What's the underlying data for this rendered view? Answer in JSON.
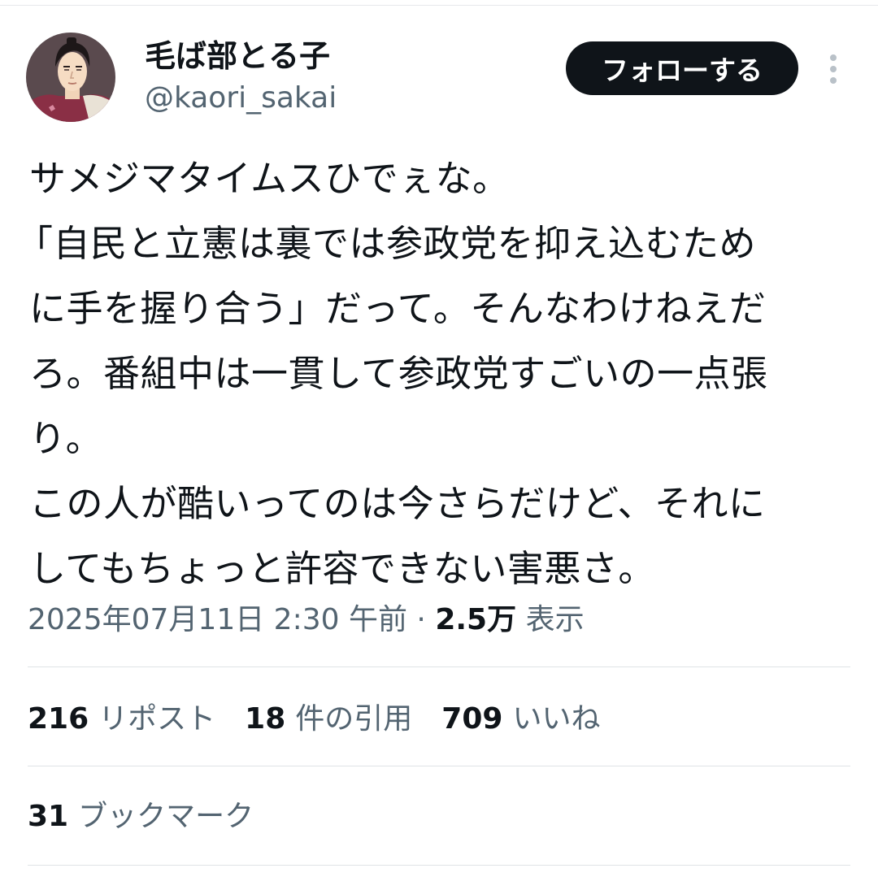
{
  "user": {
    "display_name": "毛ば部とる子",
    "handle": "@kaori_sakai",
    "avatar_icon": "avatar-illustration"
  },
  "follow_button": {
    "label": "フォローする"
  },
  "more_icon": "more-vertical-icon",
  "tweet": {
    "lines": [
      "サメジマタイムスひでぇな。",
      "「自民と立憲は裏では参政党を抑え込むため",
      "に手を握り合う」だって。そんなわけねえだ",
      "ろ。番組中は一貫して参政党すごいの一点張",
      "り。",
      "この人が酷いってのは今さらだけど、それに",
      "してもちょっと許容できない害悪さ。"
    ]
  },
  "meta": {
    "timestamp": "2025年07月11日 2:30 午前",
    "separator": "·",
    "views_count": "2.5万",
    "views_label": "表示"
  },
  "stats": {
    "reposts": {
      "count": "216",
      "label": "リポスト"
    },
    "quotes": {
      "count": "18",
      "label": "件の引用"
    },
    "likes": {
      "count": "709",
      "label": "いいね"
    },
    "bookmarks": {
      "count": "31",
      "label": "ブックマーク"
    }
  },
  "colors": {
    "text_primary": "#0f1419",
    "text_secondary": "#536471",
    "follow_button_bg": "#0f1419",
    "divider": "#dfe3e6"
  }
}
